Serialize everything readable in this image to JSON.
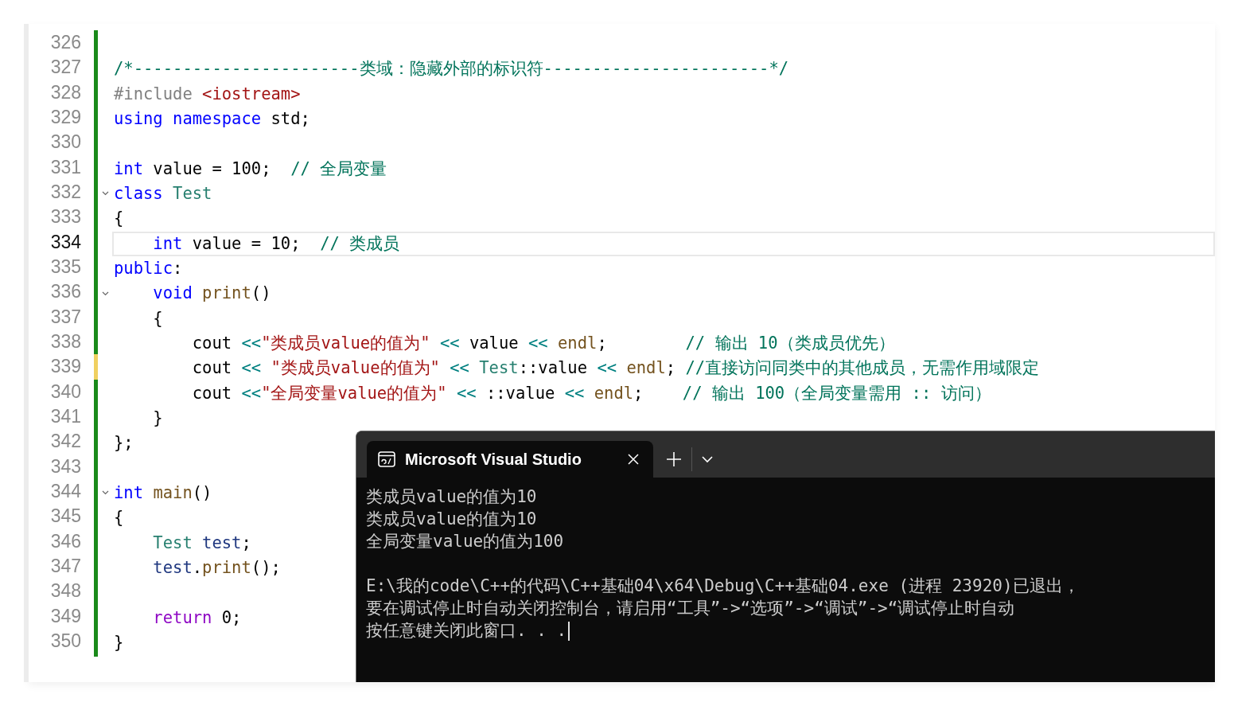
{
  "editor": {
    "lines": [
      {
        "number": "326",
        "current": false,
        "unsaved": false
      },
      {
        "number": "327",
        "current": false,
        "unsaved": false,
        "tokens": [
          {
            "kind": "comment",
            "text": "/*-----------------------类域：隐藏外部的标识符-----------------------*/"
          }
        ]
      },
      {
        "number": "328",
        "current": false,
        "unsaved": false,
        "tokens": [
          {
            "kind": "preproc",
            "text": "#include "
          },
          {
            "kind": "header",
            "text": "<iostream>"
          }
        ]
      },
      {
        "number": "329",
        "current": false,
        "unsaved": false,
        "tokens": [
          {
            "kind": "keyword",
            "text": "using namespace"
          },
          {
            "kind": "plain",
            "text": " std;"
          }
        ]
      },
      {
        "number": "330",
        "current": false,
        "unsaved": false
      },
      {
        "number": "331",
        "current": false,
        "unsaved": false,
        "tokens": [
          {
            "kind": "keyword",
            "text": "int"
          },
          {
            "kind": "plain",
            "text": " value = 100;  "
          },
          {
            "kind": "comment",
            "text": "// 全局变量"
          }
        ]
      },
      {
        "number": "332",
        "current": false,
        "unsaved": false,
        "expanded": true,
        "tokens": [
          {
            "kind": "keyword",
            "text": "class "
          },
          {
            "kind": "type",
            "text": "Test"
          }
        ]
      },
      {
        "number": "333",
        "current": false,
        "unsaved": false,
        "tokens": [
          {
            "kind": "plain",
            "text": "{"
          }
        ]
      },
      {
        "number": "334",
        "current": true,
        "unsaved": false,
        "tokens": [
          {
            "kind": "keyword",
            "text": "    int"
          },
          {
            "kind": "plain",
            "text": " value = 10;  "
          },
          {
            "kind": "comment",
            "text": "// 类成员"
          }
        ]
      },
      {
        "number": "335",
        "current": false,
        "unsaved": false,
        "tokens": [
          {
            "kind": "keyword",
            "text": "public"
          },
          {
            "kind": "plain",
            "text": ":"
          }
        ]
      },
      {
        "number": "336",
        "current": false,
        "unsaved": false,
        "expanded": true,
        "tokens": [
          {
            "kind": "keyword",
            "text": "    void "
          },
          {
            "kind": "func",
            "text": "print"
          },
          {
            "kind": "plain",
            "text": "()"
          }
        ]
      },
      {
        "number": "337",
        "current": false,
        "unsaved": false,
        "tokens": [
          {
            "kind": "plain",
            "text": "    {"
          }
        ]
      },
      {
        "number": "338",
        "current": false,
        "unsaved": false,
        "tokens": [
          {
            "kind": "plain",
            "text": "        cout "
          },
          {
            "kind": "op",
            "text": "<<"
          },
          {
            "kind": "string",
            "text": "\"类成员value的值为\""
          },
          {
            "kind": "op",
            "text": " <<"
          },
          {
            "kind": "plain",
            "text": " value "
          },
          {
            "kind": "op",
            "text": "<<"
          },
          {
            "kind": "func",
            "text": " endl"
          },
          {
            "kind": "plain",
            "text": ";        "
          },
          {
            "kind": "comment",
            "text": "// 输出 10（类成员优先）"
          }
        ]
      },
      {
        "number": "339",
        "current": false,
        "unsaved": true,
        "tokens": [
          {
            "kind": "plain",
            "text": "        cout "
          },
          {
            "kind": "op",
            "text": "<<"
          },
          {
            "kind": "string",
            "text": " \"类成员value的值为\""
          },
          {
            "kind": "op",
            "text": " <<"
          },
          {
            "kind": "type",
            "text": " Test"
          },
          {
            "kind": "plain",
            "text": "::value "
          },
          {
            "kind": "op",
            "text": "<<"
          },
          {
            "kind": "func",
            "text": " endl"
          },
          {
            "kind": "plain",
            "text": "; "
          },
          {
            "kind": "comment",
            "text": "//直接访问同类中的其他成员，无需作用域限定"
          }
        ]
      },
      {
        "number": "340",
        "current": false,
        "unsaved": false,
        "tokens": [
          {
            "kind": "plain",
            "text": "        cout "
          },
          {
            "kind": "op",
            "text": "<<"
          },
          {
            "kind": "string",
            "text": "\"全局变量value的值为\""
          },
          {
            "kind": "op",
            "text": " <<"
          },
          {
            "kind": "plain",
            "text": " ::value "
          },
          {
            "kind": "op",
            "text": "<<"
          },
          {
            "kind": "func",
            "text": " endl"
          },
          {
            "kind": "plain",
            "text": ";    "
          },
          {
            "kind": "comment",
            "text": "// 输出 100（全局变量需用 :: 访问）"
          }
        ]
      },
      {
        "number": "341",
        "current": false,
        "unsaved": false,
        "tokens": [
          {
            "kind": "plain",
            "text": "    }"
          }
        ]
      },
      {
        "number": "342",
        "current": false,
        "unsaved": false,
        "tokens": [
          {
            "kind": "plain",
            "text": "};"
          }
        ]
      },
      {
        "number": "343",
        "current": false,
        "unsaved": false
      },
      {
        "number": "344",
        "current": false,
        "unsaved": false,
        "expanded": true,
        "tokens": [
          {
            "kind": "keyword",
            "text": "int "
          },
          {
            "kind": "func",
            "text": "main"
          },
          {
            "kind": "plain",
            "text": "()"
          }
        ]
      },
      {
        "number": "345",
        "current": false,
        "unsaved": false,
        "tokens": [
          {
            "kind": "plain",
            "text": "{"
          }
        ]
      },
      {
        "number": "346",
        "current": false,
        "unsaved": false,
        "tokens": [
          {
            "kind": "type",
            "text": "    Test "
          },
          {
            "kind": "var",
            "text": "test"
          },
          {
            "kind": "plain",
            "text": ";"
          }
        ]
      },
      {
        "number": "347",
        "current": false,
        "unsaved": false,
        "tokens": [
          {
            "kind": "var",
            "text": "    test"
          },
          {
            "kind": "plain",
            "text": "."
          },
          {
            "kind": "func",
            "text": "print"
          },
          {
            "kind": "plain",
            "text": "();"
          }
        ]
      },
      {
        "number": "348",
        "current": false,
        "unsaved": false
      },
      {
        "number": "349",
        "current": false,
        "unsaved": false,
        "tokens": [
          {
            "kind": "control",
            "text": "    return"
          },
          {
            "kind": "plain",
            "text": " 0;"
          }
        ]
      },
      {
        "number": "350",
        "current": false,
        "unsaved": false,
        "tokens": [
          {
            "kind": "plain",
            "text": "}"
          }
        ]
      }
    ]
  },
  "terminal": {
    "tab_title": "Microsoft Visual Studio",
    "blocks": [
      {
        "lines": [
          "类成员value的值为10",
          "类成员value的值为10",
          "全局变量value的值为100"
        ]
      },
      {
        "lines": [
          "E:\\我的code\\C++的代码\\C++基础04\\x64\\Debug\\C++基础04.exe (进程 23920)已退出，",
          "要在调试停止时自动关闭控制台，请启用“工具”->“选项”->“调试”->“调试停止时自动",
          "按任意键关闭此窗口. . ."
        ]
      }
    ]
  }
}
